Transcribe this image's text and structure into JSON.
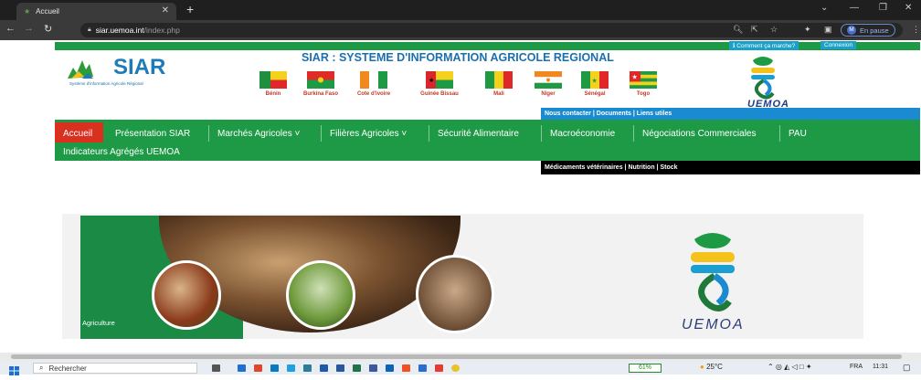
{
  "browser": {
    "tab_title": "Accueil",
    "new_tab": "+",
    "url_host": "siar.uemoa.int",
    "url_path": "/index.php",
    "profile_initial": "M",
    "profile_status": "En pause"
  },
  "header": {
    "help_label": "ℹ Comment ça marche?",
    "login_label": "Connexion",
    "logo_text": "SIAR",
    "logo_subtitle": "Système d'information Agricole Régional",
    "site_title": "SIAR : SYSTEME D'INFORMATION AGRICOLE REGIONAL",
    "countries": [
      "Bénin",
      "Burkina Faso",
      "Cote d'ivoire",
      "Guinée Bissau",
      "Mali",
      "Niger",
      "Sénégal",
      "Togo"
    ],
    "uemoa_label": "UEMOA"
  },
  "blue_links": "Nous contacter | Documents | Liens utiles",
  "nav": {
    "items": [
      "Accueil",
      "Présentation SIAR",
      "Marchés Agricoles ˅",
      "Filières Agricoles ˅",
      "Sécurité Alimentaire",
      "Macroéconomie",
      "Négociations Commerciales",
      "PAU"
    ],
    "second_row": "Indicateurs Agrégés UEMOA",
    "active": "Accueil"
  },
  "black_links": "Médicaments vétérinaires | Nutrition | Stock",
  "banner": {
    "caption": "Agriculture",
    "logo_text": "UEMOA"
  },
  "taskbar": {
    "search_placeholder": "Rechercher",
    "battery": "61%",
    "weather": "25°C",
    "lang": "FRA",
    "time": "11:31"
  },
  "colors": {
    "green": "#1e9a47",
    "red_active": "#d93020",
    "blue_bar": "#1a8bd0"
  }
}
